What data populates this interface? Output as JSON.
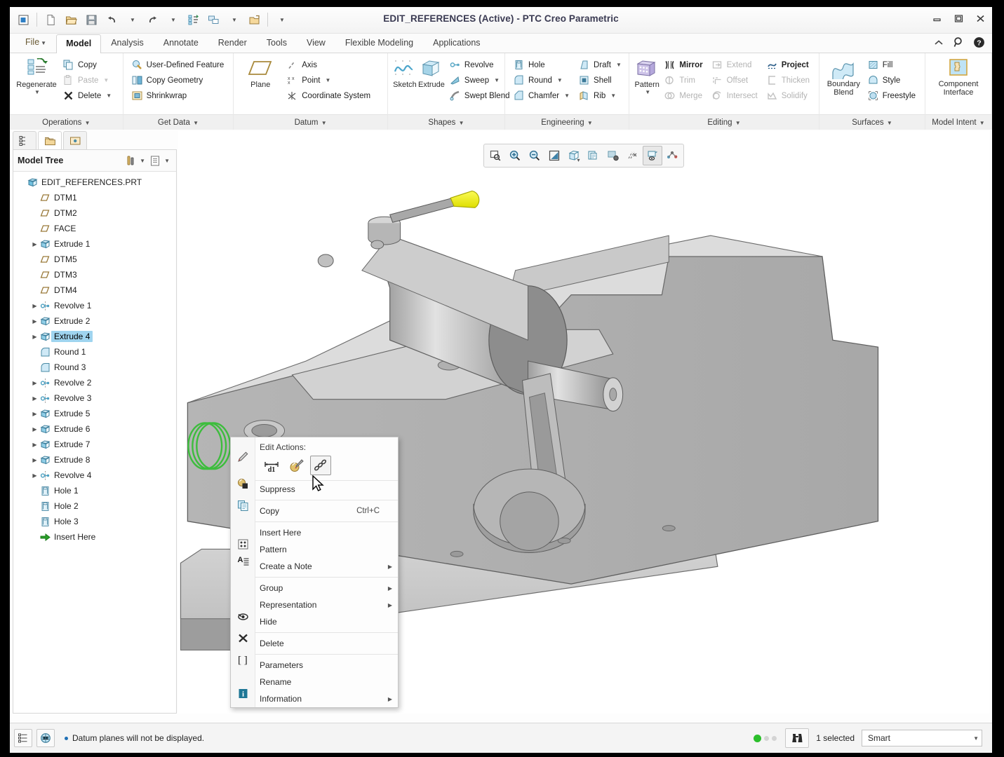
{
  "window": {
    "title": "EDIT_REFERENCES (Active) - PTC Creo Parametric",
    "minimize": "Minimize",
    "restore": "Restore",
    "close": "Close"
  },
  "quick_access": [
    {
      "name": "new-window-icon",
      "label": "New Window"
    },
    {
      "name": "new-file-icon",
      "label": "New"
    },
    {
      "name": "open-file-icon",
      "label": "Open"
    },
    {
      "name": "save-icon",
      "label": "Save"
    },
    {
      "name": "undo-icon",
      "label": "Undo"
    },
    {
      "name": "undo-dropdown",
      "label": "Undo options"
    },
    {
      "name": "redo-icon",
      "label": "Redo"
    },
    {
      "name": "redo-dropdown",
      "label": "Redo options"
    },
    {
      "name": "regenerate-icon",
      "label": "Regenerate"
    },
    {
      "name": "window-switch-icon",
      "label": "Switch Window"
    },
    {
      "name": "window-switch-dropdown",
      "label": "Window options"
    },
    {
      "name": "close-window-icon",
      "label": "Close Window"
    },
    {
      "name": "qat-dropdown",
      "label": "Customize Quick Access Toolbar"
    }
  ],
  "tabs": [
    {
      "label": "File",
      "active": false,
      "dropdown": true
    },
    {
      "label": "Model",
      "active": true
    },
    {
      "label": "Analysis",
      "active": false
    },
    {
      "label": "Annotate",
      "active": false
    },
    {
      "label": "Render",
      "active": false
    },
    {
      "label": "Tools",
      "active": false
    },
    {
      "label": "View",
      "active": false
    },
    {
      "label": "Flexible Modeling",
      "active": false
    },
    {
      "label": "Applications",
      "active": false
    }
  ],
  "tab_right": [
    {
      "name": "collapse-ribbon-icon",
      "label": "Collapse Ribbon"
    },
    {
      "name": "search-icon",
      "label": "Search"
    },
    {
      "name": "help-icon",
      "label": "Help"
    }
  ],
  "ribbon": {
    "groups": [
      {
        "title": "Operations",
        "big": [
          {
            "label": "Regenerate",
            "icon": "regenerate-icon",
            "dropdown": true
          }
        ],
        "items": [
          {
            "label": "Copy",
            "icon": "copy-icon",
            "disabled": false
          },
          {
            "label": "Paste",
            "icon": "paste-icon",
            "disabled": true,
            "dropdown": true
          },
          {
            "label": "Delete",
            "icon": "delete-x-icon",
            "disabled": false,
            "dropdown": true
          }
        ]
      },
      {
        "title": "Get Data",
        "items": [
          {
            "label": "User-Defined Feature",
            "icon": "udf-icon"
          },
          {
            "label": "Copy Geometry",
            "icon": "copy-geometry-icon"
          },
          {
            "label": "Shrinkwrap",
            "icon": "shrinkwrap-icon"
          }
        ]
      },
      {
        "title": "Datum",
        "big": [
          {
            "label": "Plane",
            "icon": "plane-icon"
          }
        ],
        "items": [
          {
            "label": "Axis",
            "icon": "axis-icon"
          },
          {
            "label": "Point",
            "icon": "point-icon",
            "dropdown": true
          },
          {
            "label": "Coordinate System",
            "icon": "coordinate-system-icon"
          }
        ]
      },
      {
        "title": "Shapes",
        "big": [
          {
            "label": "Sketch",
            "icon": "sketch-icon"
          },
          {
            "label": "Extrude",
            "icon": "extrude-icon"
          }
        ],
        "items": [
          {
            "label": "Revolve",
            "icon": "revolve-icon"
          },
          {
            "label": "Sweep",
            "icon": "sweep-icon",
            "dropdown": true
          },
          {
            "label": "Swept Blend",
            "icon": "swept-blend-icon"
          }
        ]
      },
      {
        "title": "Engineering",
        "items": [
          {
            "label": "Hole",
            "icon": "hole-icon"
          },
          {
            "label": "Round",
            "icon": "round-icon",
            "dropdown": true
          },
          {
            "label": "Chamfer",
            "icon": "chamfer-icon",
            "dropdown": true
          }
        ],
        "items2": [
          {
            "label": "Draft",
            "icon": "draft-icon",
            "dropdown": true
          },
          {
            "label": "Shell",
            "icon": "shell-icon"
          },
          {
            "label": "Rib",
            "icon": "rib-icon",
            "dropdown": true
          }
        ]
      },
      {
        "title": "Editing",
        "big": [
          {
            "label": "Pattern",
            "icon": "pattern-icon",
            "dropdown": true
          }
        ],
        "items": [
          {
            "label": "Mirror",
            "icon": "mirror-icon",
            "bold": true
          },
          {
            "label": "Trim",
            "icon": "trim-icon",
            "disabled": true
          },
          {
            "label": "Merge",
            "icon": "merge-icon",
            "disabled": true
          }
        ],
        "items2": [
          {
            "label": "Extend",
            "icon": "extend-icon",
            "disabled": true
          },
          {
            "label": "Offset",
            "icon": "offset-icon",
            "disabled": true
          },
          {
            "label": "Intersect",
            "icon": "intersect-icon",
            "disabled": true
          }
        ],
        "items3": [
          {
            "label": "Project",
            "icon": "project-icon",
            "bold": true
          },
          {
            "label": "Thicken",
            "icon": "thicken-icon",
            "disabled": true
          },
          {
            "label": "Solidify",
            "icon": "solidify-icon",
            "disabled": true
          }
        ]
      },
      {
        "title": "Surfaces",
        "big": [
          {
            "label": "Boundary Blend",
            "icon": "boundary-blend-icon"
          }
        ],
        "items": [
          {
            "label": "Fill",
            "icon": "fill-icon"
          },
          {
            "label": "Style",
            "icon": "style-icon"
          },
          {
            "label": "Freestyle",
            "icon": "freestyle-icon"
          }
        ]
      },
      {
        "title": "Model Intent",
        "big": [
          {
            "label": "Component Interface",
            "icon": "component-interface-icon"
          }
        ],
        "items": []
      }
    ]
  },
  "nav_tabs": [
    {
      "name": "model-tree-tab",
      "active": false
    },
    {
      "name": "layer-tree-tab",
      "active": true
    },
    {
      "name": "folder-browser-tab",
      "active": false
    }
  ],
  "model_tree": {
    "header": "Model Tree",
    "filter_button": "filter-settings-icon",
    "display_button": "tree-display-icon",
    "items": [
      {
        "label": "EDIT_REFERENCES.PRT",
        "icon": "part-icon",
        "indent": 0,
        "expand": false,
        "selected": false
      },
      {
        "label": "DTM1",
        "icon": "datum-plane-icon",
        "indent": 1,
        "expand": false,
        "selected": false
      },
      {
        "label": "DTM2",
        "icon": "datum-plane-icon",
        "indent": 1,
        "expand": false,
        "selected": false
      },
      {
        "label": "FACE",
        "icon": "datum-plane-icon",
        "indent": 1,
        "expand": false,
        "selected": false
      },
      {
        "label": "Extrude 1",
        "icon": "extrude-feature-icon",
        "indent": 1,
        "expand": true,
        "selected": false
      },
      {
        "label": "DTM5",
        "icon": "datum-plane-icon",
        "indent": 1,
        "expand": false,
        "selected": false
      },
      {
        "label": "DTM3",
        "icon": "datum-plane-icon",
        "indent": 1,
        "expand": false,
        "selected": false
      },
      {
        "label": "DTM4",
        "icon": "datum-plane-icon",
        "indent": 1,
        "expand": false,
        "selected": false
      },
      {
        "label": "Revolve 1",
        "icon": "revolve-feature-icon",
        "indent": 1,
        "expand": true,
        "selected": false
      },
      {
        "label": "Extrude 2",
        "icon": "extrude-feature-icon",
        "indent": 1,
        "expand": true,
        "selected": false
      },
      {
        "label": "Extrude 4",
        "icon": "extrude-feature-icon",
        "indent": 1,
        "expand": true,
        "selected": true
      },
      {
        "label": "Round 1",
        "icon": "round-feature-icon",
        "indent": 1,
        "expand": false,
        "selected": false
      },
      {
        "label": "Round 3",
        "icon": "round-feature-icon",
        "indent": 1,
        "expand": false,
        "selected": false
      },
      {
        "label": "Revolve 2",
        "icon": "revolve-feature-icon",
        "indent": 1,
        "expand": true,
        "selected": false
      },
      {
        "label": "Revolve 3",
        "icon": "revolve-feature-icon",
        "indent": 1,
        "expand": true,
        "selected": false
      },
      {
        "label": "Extrude 5",
        "icon": "extrude-feature-icon",
        "indent": 1,
        "expand": true,
        "selected": false
      },
      {
        "label": "Extrude 6",
        "icon": "extrude-feature-icon",
        "indent": 1,
        "expand": true,
        "selected": false
      },
      {
        "label": "Extrude 7",
        "icon": "extrude-feature-icon",
        "indent": 1,
        "expand": true,
        "selected": false
      },
      {
        "label": "Extrude 8",
        "icon": "extrude-feature-icon",
        "indent": 1,
        "expand": true,
        "selected": false
      },
      {
        "label": "Revolve 4",
        "icon": "revolve-feature-icon",
        "indent": 1,
        "expand": true,
        "selected": false
      },
      {
        "label": "Hole 1",
        "icon": "hole-feature-icon",
        "indent": 1,
        "expand": false,
        "selected": false
      },
      {
        "label": "Hole 2",
        "icon": "hole-feature-icon",
        "indent": 1,
        "expand": false,
        "selected": false
      },
      {
        "label": "Hole 3",
        "icon": "hole-feature-icon",
        "indent": 1,
        "expand": false,
        "selected": false
      },
      {
        "label": "Insert Here",
        "icon": "insert-here-icon",
        "indent": 1,
        "expand": false,
        "selected": false
      }
    ]
  },
  "graphics_toolbar": [
    {
      "name": "zoom-fit-icon",
      "label": "Refit"
    },
    {
      "name": "zoom-in-icon",
      "label": "Zoom In"
    },
    {
      "name": "zoom-out-icon",
      "label": "Zoom Out"
    },
    {
      "name": "repaint-icon",
      "label": "Repaint"
    },
    {
      "name": "display-style-icon",
      "label": "Display Style",
      "dropdown": true
    },
    {
      "name": "saved-views-icon",
      "label": "Saved Orientations",
      "dropdown": true
    },
    {
      "name": "scene-icon",
      "label": "Scene"
    },
    {
      "name": "datum-display-icon",
      "label": "Datum Display Filters",
      "dropdown": true
    },
    {
      "name": "annotation-display-icon",
      "label": "Annotation Display",
      "active": true
    },
    {
      "name": "spin-center-icon",
      "label": "Spin Center"
    }
  ],
  "context_menu": {
    "edit_actions_header": "Edit Actions:",
    "edit_actions": [
      {
        "name": "edit-dimensions-icon",
        "label": "Edit Dimensions",
        "hover": false
      },
      {
        "name": "edit-definition-icon",
        "label": "Edit Definition",
        "hover": false
      },
      {
        "name": "edit-references-icon",
        "label": "Edit References",
        "hover": true
      }
    ],
    "items": [
      {
        "label": "Suppress",
        "icon": "suppress-icon",
        "shortcut": "",
        "submenu": false,
        "sep_before": false
      },
      {
        "label": "Copy",
        "icon": "copy-menu-icon",
        "shortcut": "Ctrl+C",
        "submenu": false,
        "sep_before": true
      },
      {
        "label": "Insert Here",
        "icon": "",
        "shortcut": "",
        "submenu": false,
        "sep_before": true
      },
      {
        "label": "Pattern",
        "icon": "pattern-menu-icon",
        "shortcut": "",
        "submenu": false,
        "sep_before": false
      },
      {
        "label": "Create a Note",
        "icon": "note-icon",
        "shortcut": "",
        "submenu": true,
        "sep_before": false
      },
      {
        "label": "Group",
        "icon": "",
        "shortcut": "",
        "submenu": true,
        "sep_before": true
      },
      {
        "label": "Representation",
        "icon": "",
        "shortcut": "",
        "submenu": true,
        "sep_before": false
      },
      {
        "label": "Hide",
        "icon": "hide-eye-icon",
        "shortcut": "",
        "submenu": false,
        "sep_before": false
      },
      {
        "label": "Delete",
        "icon": "delete-menu-icon",
        "shortcut": "",
        "submenu": false,
        "sep_before": true
      },
      {
        "label": "Parameters",
        "icon": "parameters-icon",
        "shortcut": "",
        "submenu": false,
        "sep_before": true
      },
      {
        "label": "Rename",
        "icon": "",
        "shortcut": "",
        "submenu": false,
        "sep_before": false
      },
      {
        "label": "Information",
        "icon": "information-icon",
        "shortcut": "",
        "submenu": true,
        "sep_before": false
      }
    ]
  },
  "status_bar": {
    "left_buttons": [
      {
        "name": "model-tree-toggle-icon",
        "label": "Show Navigator"
      },
      {
        "name": "browser-toggle-icon",
        "label": "Show Web Browser"
      }
    ],
    "message": "Datum planes will not be displayed.",
    "search_icon": "binoculars-search-icon",
    "selection_count": "1 selected",
    "selection_mode": "Smart",
    "led_active_color": "#2bbf2b",
    "led_inactive_color": "#d4d4d4"
  },
  "colors": {
    "accent": "#9fd4ef",
    "model_grey": "#b8b8b8",
    "model_light": "#e0e0e0",
    "model_dark": "#8f8f8f",
    "handle_yellow": "#f2ef14",
    "highlight_green": "#46c846"
  }
}
